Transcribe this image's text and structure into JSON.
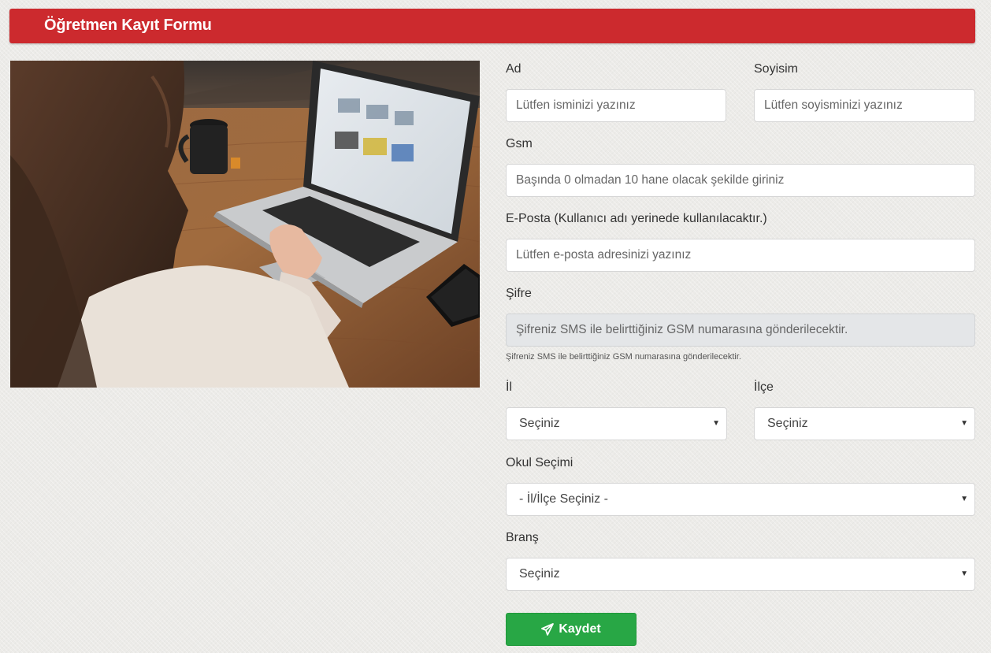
{
  "header": {
    "title": "Öğretmen Kayıt Formu"
  },
  "form": {
    "first_name": {
      "label": "Ad",
      "placeholder": "Lütfen isminizi yazınız"
    },
    "last_name": {
      "label": "Soyisim",
      "placeholder": "Lütfen soyisminizi yazınız"
    },
    "gsm": {
      "label": "Gsm",
      "placeholder": "Başında 0 olmadan 10 hane olacak şekilde giriniz"
    },
    "email": {
      "label": "E-Posta (Kullanıcı adı yerinede kullanılacaktır.)",
      "placeholder": "Lütfen e-posta adresinizi yazınız"
    },
    "password": {
      "label": "Şifre",
      "placeholder": "Şifreniz SMS ile belirttiğiniz GSM numarasına gönderilecektir.",
      "help": "Şifreniz SMS ile belirttiğiniz GSM numarasına gönderilecektir."
    },
    "province": {
      "label": "İl",
      "selected": "Seçiniz"
    },
    "district": {
      "label": "İlçe",
      "selected": "Seçiniz"
    },
    "school": {
      "label": "Okul Seçimi",
      "selected": "- İl/İlçe Seçiniz -"
    },
    "branch": {
      "label": "Branş",
      "selected": "Seçiniz"
    },
    "submit": {
      "label": "Kaydet",
      "icon": "paper-plane-icon"
    }
  },
  "colors": {
    "header": "#cc2a2e",
    "submit": "#28a745",
    "disabled_input": "#e4e6e8"
  }
}
